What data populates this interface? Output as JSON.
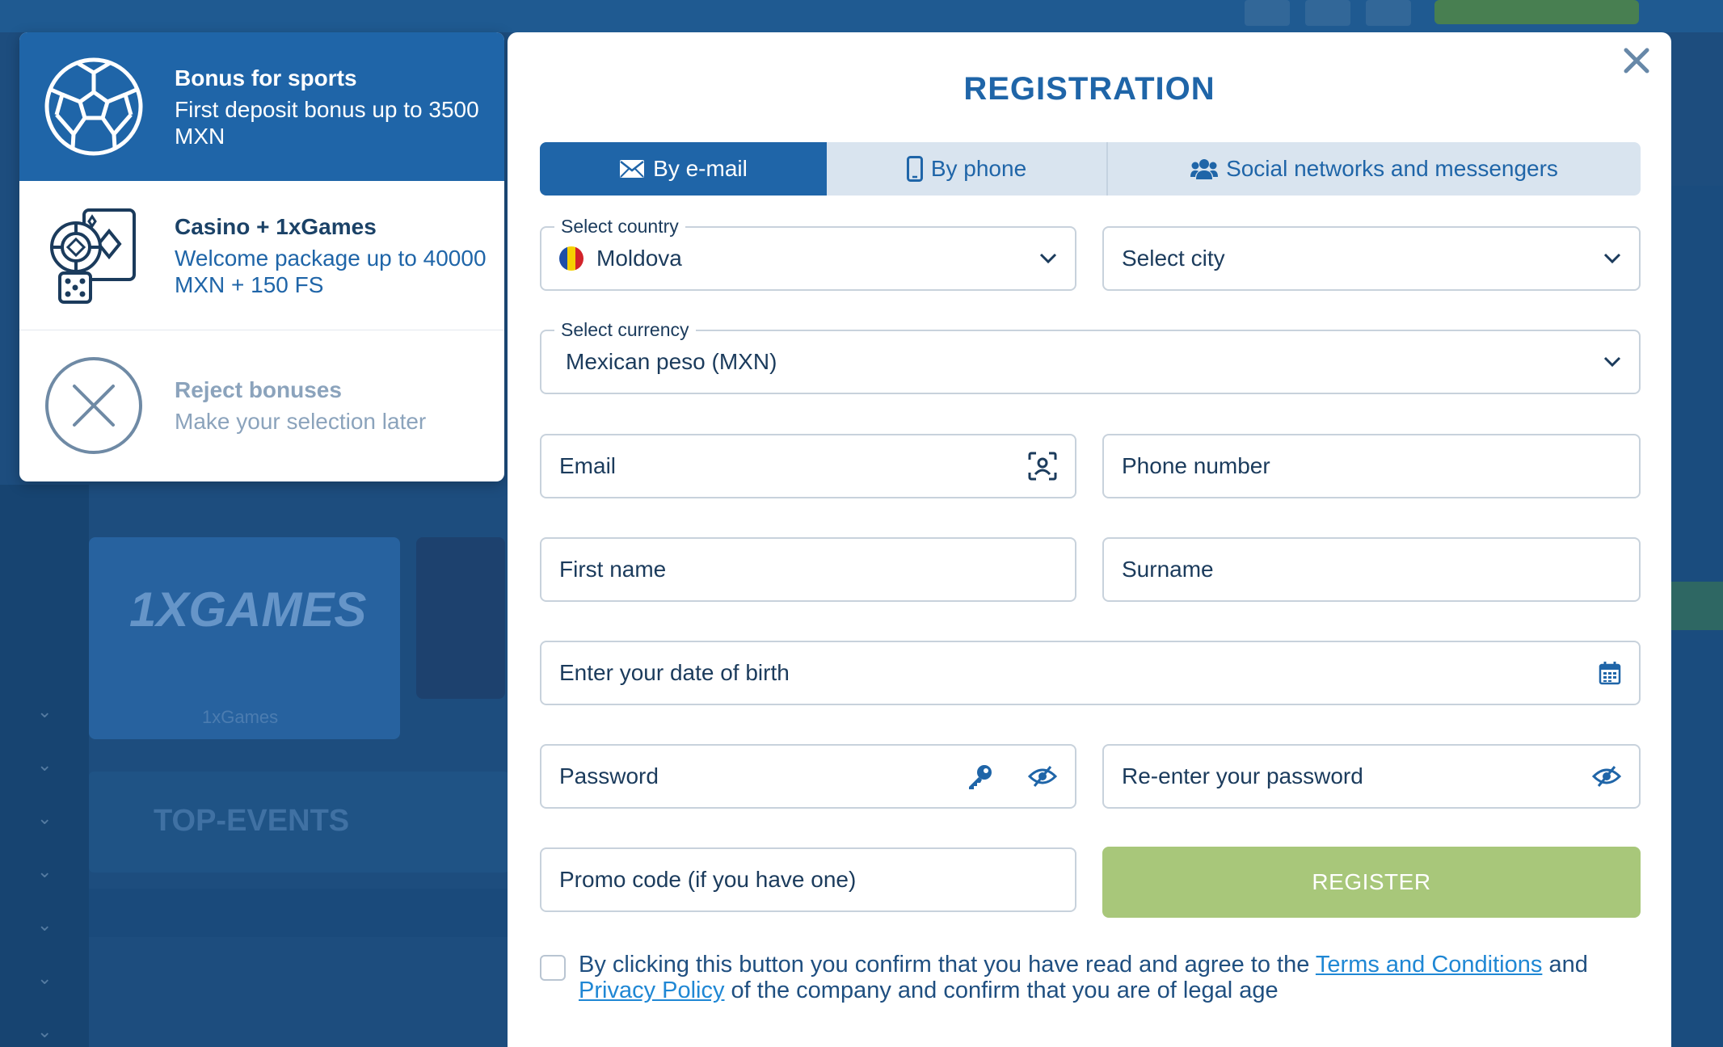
{
  "background": {
    "games_label": "1XGAMES",
    "games_sub": "1xGames",
    "top_events": "TOP-EVENTS"
  },
  "bonuses": [
    {
      "title": "Bonus for sports",
      "desc": "First deposit bonus up to 3500 MXN",
      "icon": "soccer-ball-icon",
      "selected": true
    },
    {
      "title": "Casino + 1xGames",
      "desc": "Welcome package up to 40000 MXN + 150 FS",
      "icon": "casino-chips-cards-icon",
      "selected": false
    },
    {
      "title": "Reject bonuses",
      "desc": "Make your selection later",
      "icon": "reject-x-icon",
      "selected": false
    }
  ],
  "modal": {
    "title": "REGISTRATION",
    "close_icon": "close-icon"
  },
  "tabs": [
    {
      "label": "By e-mail",
      "icon": "envelope-icon",
      "active": true
    },
    {
      "label": "By phone",
      "icon": "mobile-phone-icon",
      "active": false
    },
    {
      "label": "Social networks and messengers",
      "icon": "users-icon",
      "active": false
    }
  ],
  "form": {
    "country": {
      "label": "Select country",
      "value": "Moldova"
    },
    "city": {
      "placeholder": "Select city"
    },
    "currency": {
      "label": "Select currency",
      "value": "Mexican peso (MXN)"
    },
    "email": {
      "placeholder": "Email"
    },
    "phone": {
      "placeholder": "Phone number"
    },
    "first_name": {
      "placeholder": "First name"
    },
    "surname": {
      "placeholder": "Surname"
    },
    "dob": {
      "placeholder": "Enter your date of birth"
    },
    "password": {
      "placeholder": "Password"
    },
    "password_confirm": {
      "placeholder": "Re-enter your password"
    },
    "promo": {
      "placeholder": "Promo code (if you have one)"
    },
    "register_label": "REGISTER"
  },
  "agreement": {
    "text_1": "By clicking this button you confirm that you have read and agree to the ",
    "terms_link": "Terms and Conditions",
    "text_2": " and ",
    "privacy_link": "Privacy Policy",
    "text_3": " of the company and confirm that you are of legal age",
    "checked": false
  },
  "colors": {
    "primary": "#1f65a8",
    "register_disabled": "#a8c77a",
    "link": "#1f87d4"
  }
}
